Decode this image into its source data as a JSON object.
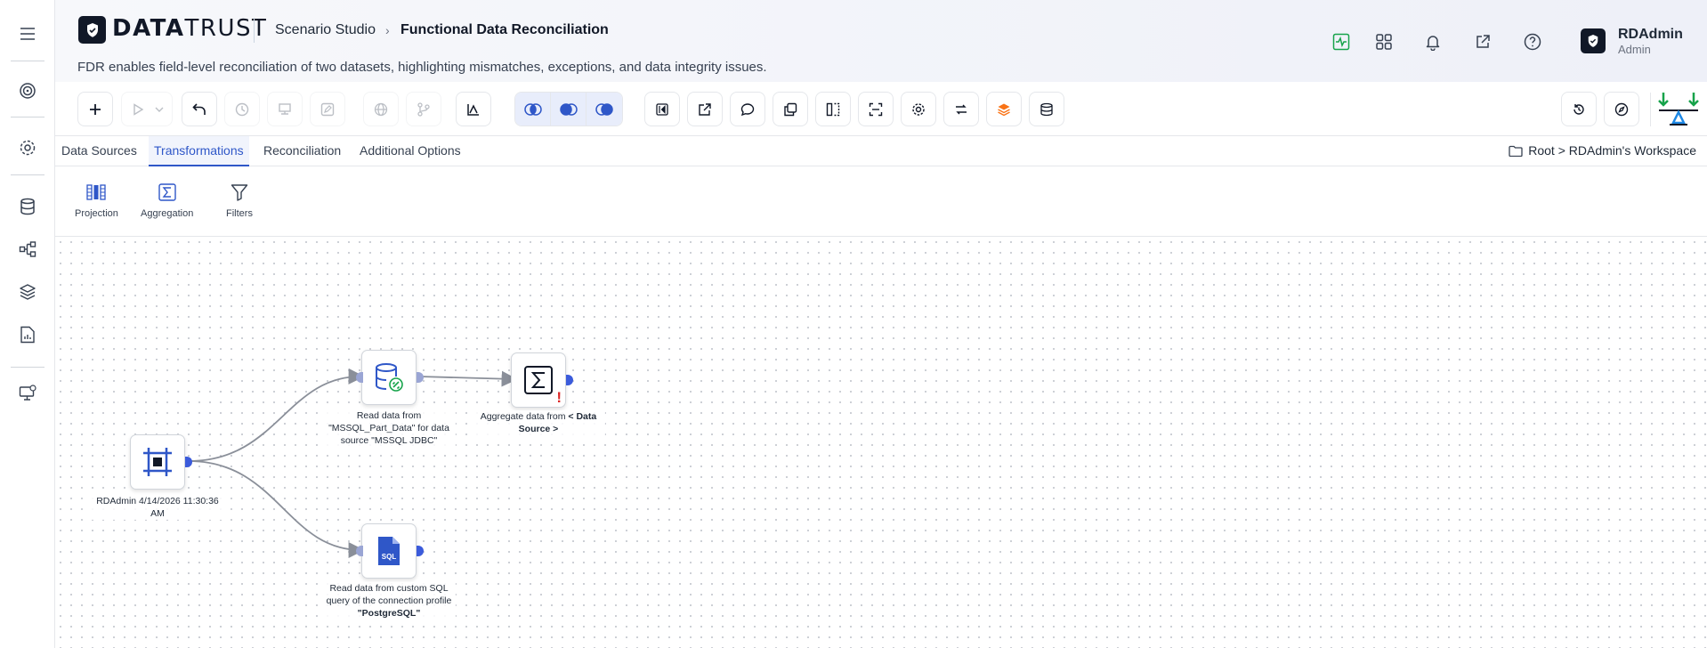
{
  "app": {
    "logo_text_bold": "DATA",
    "logo_text_light": "TRUST",
    "breadcrumb_parent": "Scenario Studio",
    "breadcrumb_current": "Functional Data Reconciliation",
    "description": "FDR enables field-level reconciliation of two datasets, highlighting mismatches, exceptions, and data integrity issues."
  },
  "user": {
    "name": "RDAdmin",
    "role": "Admin"
  },
  "tabs": [
    {
      "label": "Data Sources"
    },
    {
      "label": "Transformations"
    },
    {
      "label": "Reconciliation"
    },
    {
      "label": "Additional Options"
    }
  ],
  "active_tab": "Transformations",
  "workspace_path": "Root > RDAdmin's Workspace",
  "subtools": [
    {
      "label": "Projection",
      "icon": "projection-icon"
    },
    {
      "label": "Aggregation",
      "icon": "sigma-icon"
    },
    {
      "label": "Filters",
      "icon": "filter-icon"
    }
  ],
  "nodes": {
    "start": {
      "label": "RDAdmin 4/14/2026 11:30:36 AM",
      "icon": "frame-icon"
    },
    "mssql": {
      "label": "Read data from \"MSSQL_Part_Data\" for data source \"MSSQL JDBC\"",
      "icon": "database-link-icon"
    },
    "aggregate": {
      "label_prefix": "Aggregate data from ",
      "label_bold": "< Data Source >",
      "icon": "sigma-icon",
      "warning": "!"
    },
    "sql": {
      "label_prefix": "Read data from custom SQL query of the connection profile ",
      "label_bold": "\"PostgreSQL\"",
      "icon": "sql-file-icon",
      "icon_text": "SQL"
    }
  },
  "colors": {
    "accent": "#2f57c8",
    "port": "#3b5bdb",
    "warning": "#dc2626",
    "health": "#16a34a"
  }
}
